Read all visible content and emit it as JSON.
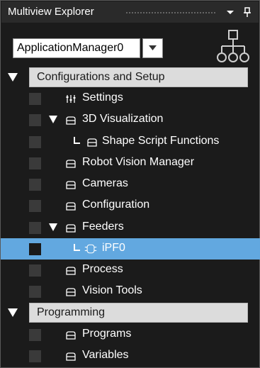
{
  "panel": {
    "title": "Multiview Explorer",
    "dropdown_icon": "chevron-down-icon",
    "pin_icon": "pin-icon"
  },
  "app_selector": {
    "value": "ApplicationManager0",
    "button_icon": "triangle-down-icon"
  },
  "hierarchy_icon": "hierarchy-icon",
  "tree": {
    "group_config": "Configurations and Setup",
    "settings": "Settings",
    "vis3d": "3D Visualization",
    "shape_script": "Shape Script Functions",
    "robot_vision": "Robot Vision Manager",
    "cameras": "Cameras",
    "configuration": "Configuration",
    "feeders": "Feeders",
    "ipf0": "iPF0",
    "process": "Process",
    "vision_tools": "Vision Tools",
    "group_programming": "Programming",
    "programs": "Programs",
    "variables": "Variables"
  },
  "colors": {
    "selected_row": "#62a8e0",
    "group_bar": "#dcdcdc",
    "background": "#1b1b1b"
  }
}
